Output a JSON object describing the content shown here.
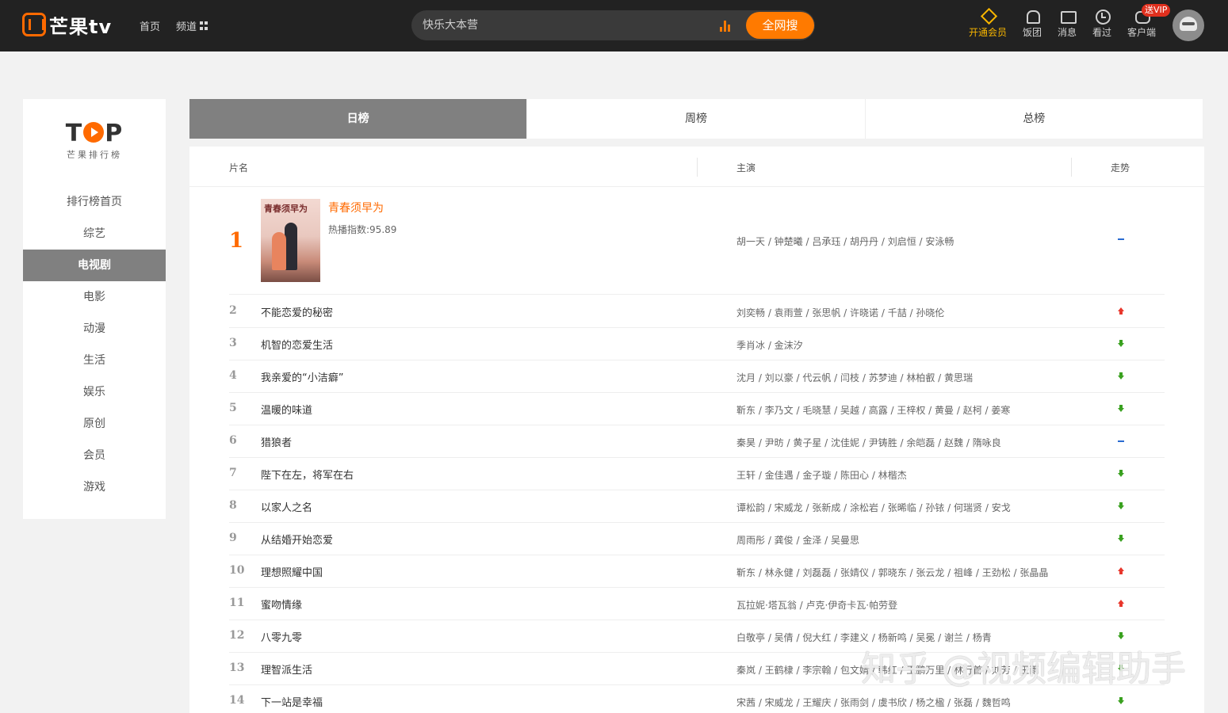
{
  "header": {
    "logo_text": "芒果tv",
    "nav": {
      "home": "首页",
      "channel": "频道"
    },
    "search": {
      "placeholder": "快乐大本营",
      "button_label": "全网搜"
    },
    "actions": {
      "vip": "开通会员",
      "fan_club": "饭团",
      "messages": "消息",
      "history": "看过",
      "client": "客户端",
      "client_badge": "送VIP"
    }
  },
  "sidebar": {
    "logo_word": "TOP",
    "logo_sub": "芒果排行榜",
    "items": [
      "排行榜首页",
      "综艺",
      "电视剧",
      "电影",
      "动漫",
      "生活",
      "娱乐",
      "原创",
      "会员",
      "游戏"
    ],
    "active_index": 2
  },
  "tabs": [
    "日榜",
    "周榜",
    "总榜"
  ],
  "table": {
    "headers": {
      "name": "片名",
      "cast": "主演",
      "trend": "走势"
    },
    "first": {
      "rank": "1",
      "title": "青春须早为",
      "poster_title": "青春须早为",
      "heat": "热播指数:95.89",
      "cast": "胡一天 / 钟楚曦 / 吕承珏 / 胡丹丹 / 刘启恒 / 安泳畅",
      "trend": "flat"
    },
    "rows": [
      {
        "rank": "2",
        "title": "不能恋爱的秘密",
        "cast": "刘奕畅 / 袁雨萱 / 张思帆 / 许晓诺 / 千喆 / 孙晓伦",
        "trend": "up"
      },
      {
        "rank": "3",
        "title": "机智的恋爱生活",
        "cast": "季肖冰 / 金沫汐",
        "trend": "down"
      },
      {
        "rank": "4",
        "title": "我亲爱的“小洁癖”",
        "cast": "沈月 / 刘以豪 / 代云帆 / 闫枝 / 苏梦迪 / 林柏叡 / 黄思瑞",
        "trend": "down"
      },
      {
        "rank": "5",
        "title": "温暖的味道",
        "cast": "靳东 / 李乃文 / 毛晓慧 / 吴越 / 高露 / 王梓权 / 黄曼 / 赵柯 / 姜寒",
        "trend": "down"
      },
      {
        "rank": "6",
        "title": "猎狼者",
        "cast": "秦昊 / 尹昉 / 黄子星 / 沈佳妮 / 尹铸胜 / 余皑磊 / 赵魏 / 隋咏良",
        "trend": "flat"
      },
      {
        "rank": "7",
        "title": "陛下在左，将军在右",
        "cast": "王轩 / 金佳遇 / 金子璇 / 陈田心 / 林楷杰",
        "trend": "down"
      },
      {
        "rank": "8",
        "title": "以家人之名",
        "cast": "谭松韵 / 宋威龙 / 张新成 / 涂松岩 / 张晞临 / 孙铱 / 何瑞贤 / 安戈",
        "trend": "down"
      },
      {
        "rank": "9",
        "title": "从结婚开始恋爱",
        "cast": "周雨彤 / 龚俊 / 金泽 / 吴曼思",
        "trend": "down"
      },
      {
        "rank": "10",
        "title": "理想照耀中国",
        "cast": "靳东 / 林永健 / 刘磊磊 / 张婧仪 / 郭晓东 / 张云龙 / 祖峰 / 王劲松 / 张晶晶",
        "trend": "up"
      },
      {
        "rank": "11",
        "title": "蜜吻情缘",
        "cast": "瓦拉妮·塔瓦翁 / 卢克·伊奇卡瓦·帕劳登",
        "trend": "up"
      },
      {
        "rank": "12",
        "title": "八零九零",
        "cast": "白敬亭 / 吴倩 / 倪大红 / 李建义 / 杨新鸣 / 吴冕 / 谢兰 / 杨青",
        "trend": "down"
      },
      {
        "rank": "13",
        "title": "理智派生活",
        "cast": "秦岚 / 王鹤棣 / 李宗翰 / 包文婧 / 韩红 / 王鹏万里 / 林行首 / 刘芳 / 王雨",
        "trend": "down"
      },
      {
        "rank": "14",
        "title": "下一站是幸福",
        "cast": "宋茜 / 宋威龙 / 王耀庆 / 张雨剑 / 虞书欣 / 杨之楹 / 张磊 / 魏哲鸣",
        "trend": "down"
      }
    ]
  },
  "watermark": "知乎 @视频编辑助手",
  "colors": {
    "header_bg": "#222222",
    "accent": "#ff7a00",
    "active_gray": "#808080",
    "up": "#e8372c",
    "down": "#3aa120",
    "flat": "#2a6bd1"
  }
}
